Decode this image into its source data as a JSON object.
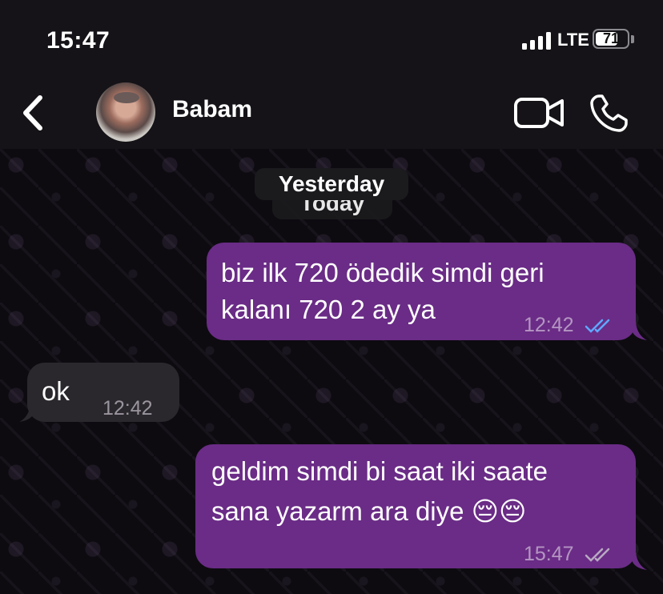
{
  "status_bar": {
    "time": "15:47",
    "network": "LTE",
    "battery": "71",
    "battery_level": 0.71
  },
  "header": {
    "contact_name": "Babam",
    "icons": [
      "back-icon",
      "video-call-icon",
      "voice-call-icon"
    ]
  },
  "date_separators": {
    "behind": "Today",
    "front": "Yesterday"
  },
  "messages": [
    {
      "direction": "outgoing",
      "text_line1": "biz ilk 720 ödedik simdi geri",
      "text_line2": "kalanı 720 2 ay ya",
      "time": "12:42",
      "status": "read"
    },
    {
      "direction": "incoming",
      "text": "ok",
      "time": "12:42"
    },
    {
      "direction": "outgoing",
      "text_line1": "geldim simdi bi saat iki saate",
      "text_line2": "sana yazarm ara diye 😔😔",
      "time": "15:47",
      "status": "delivered"
    }
  ],
  "colors": {
    "outgoing_bubble": "#6a2c86",
    "incoming_bubble": "#2a282c",
    "read_ticks": "#5fa8ff",
    "delivered_ticks": "#b8a9c2"
  }
}
